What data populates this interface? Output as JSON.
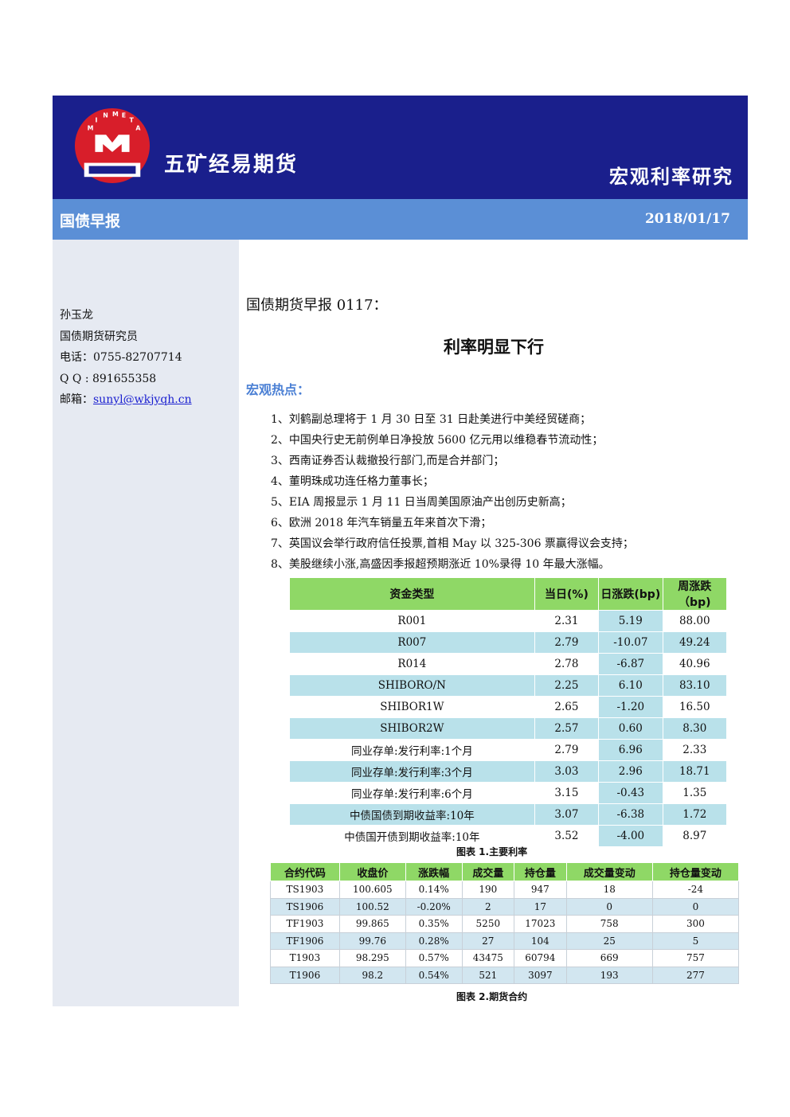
{
  "header": {
    "company": "五矿经易期货",
    "department": "宏观利率研究",
    "logo_text": "MINMETALS LEOIOTOIOI",
    "bar_title": "国债早报",
    "date": "2018/01/17"
  },
  "author": {
    "name": "孙玉龙",
    "title": "国债期货研究员",
    "phone": "电话：0755-82707714",
    "qq": "Q Q : 891655358",
    "email_label": "邮箱：",
    "email": "sunyl@wkjyqh.cn"
  },
  "report": {
    "title_prefix": "国债期货早报",
    "title_num": " 0117：",
    "headline": "利率明显下行",
    "hot_title": "宏观热点：",
    "news": [
      "1、刘鹤副总理将于 1 月 30 日至 31 日赴美进行中美经贸磋商；",
      "2、中国央行史无前例单日净投放 5600 亿元用以维稳春节流动性；",
      "3、西南证券否认裁撤投行部门,而是合并部门；",
      "4、董明珠成功连任格力董事长；",
      "5、EIA 周报显示 1 月 11 日当周美国原油产出创历史新高；",
      "6、欧洲 2018 年汽车销量五年来首次下滑；",
      "7、英国议会举行政府信任投票,首相 May 以 325-306 票赢得议会支持；",
      "8、美股继续小涨,高盛因季报超预期涨近 10%录得 10 年最大涨幅。"
    ]
  },
  "rates_table": {
    "headers": [
      "资金类型",
      "当日(%)",
      "日涨跌(bp)",
      "周涨跌（bp)"
    ],
    "rows": [
      [
        "R001",
        "2.31",
        "5.19",
        "88.00"
      ],
      [
        "R007",
        "2.79",
        "-10.07",
        "49.24"
      ],
      [
        "R014",
        "2.78",
        "-6.87",
        "40.96"
      ],
      [
        "SHIBORO/N",
        "2.25",
        "6.10",
        "83.10"
      ],
      [
        "SHIBOR1W",
        "2.65",
        "-1.20",
        "16.50"
      ],
      [
        "SHIBOR2W",
        "2.57",
        "0.60",
        "8.30"
      ],
      [
        "同业存单:发行利率:1个月",
        "2.79",
        "6.96",
        "2.33"
      ],
      [
        "同业存单:发行利率:3个月",
        "3.03",
        "2.96",
        "18.71"
      ],
      [
        "同业存单:发行利率:6个月",
        "3.15",
        "-0.43",
        "1.35"
      ],
      [
        "中债国债到期收益率:10年",
        "3.07",
        "-6.38",
        "1.72"
      ],
      [
        "中债国开债到期收益率:10年",
        "3.52",
        "-4.00",
        "8.97"
      ]
    ],
    "caption": "图表 1.主要利率"
  },
  "futures_table": {
    "headers": [
      "合约代码",
      "收盘价",
      "涨跌幅",
      "成交量",
      "持仓量",
      "成交量变动",
      "持仓量变动"
    ],
    "rows": [
      [
        "TS1903",
        "100.605",
        "0.14%",
        "190",
        "947",
        "18",
        "-24"
      ],
      [
        "TS1906",
        "100.52",
        "-0.20%",
        "2",
        "17",
        "0",
        "0"
      ],
      [
        "TF1903",
        "99.865",
        "0.35%",
        "5250",
        "17023",
        "758",
        "300"
      ],
      [
        "TF1906",
        "99.76",
        "0.28%",
        "27",
        "104",
        "25",
        "5"
      ],
      [
        "T1903",
        "98.295",
        "0.57%",
        "43475",
        "60794",
        "669",
        "757"
      ],
      [
        "T1906",
        "98.2",
        "0.54%",
        "521",
        "3097",
        "193",
        "277"
      ]
    ],
    "caption": "图表 2.期货合约"
  }
}
